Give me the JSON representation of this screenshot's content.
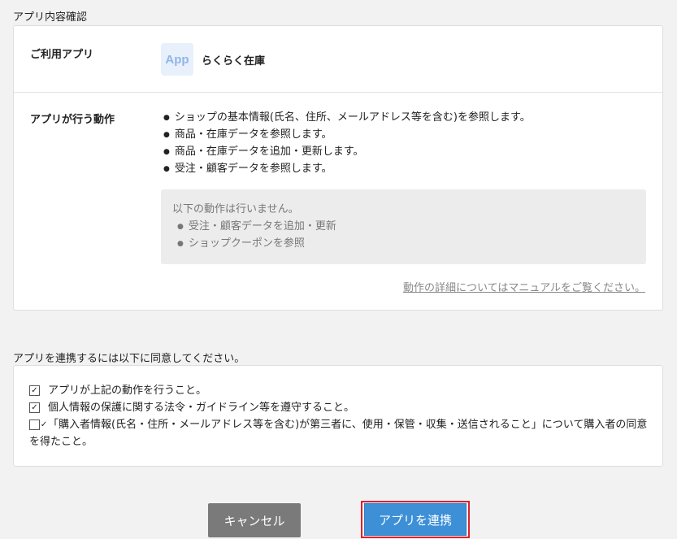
{
  "section_title": "アプリ内容確認",
  "app": {
    "label": "ご利用アプリ",
    "icon_text": "App",
    "name": "らくらく在庫"
  },
  "actions": {
    "label": "アプリが行う動作",
    "items": [
      "ショップの基本情報(氏名、住所、メールアドレス等を含む)を参照します。",
      "商品・在庫データを参照します。",
      "商品・在庫データを追加・更新します。",
      "受注・顧客データを参照します。"
    ],
    "not_performed": {
      "title": "以下の動作は行いません。",
      "items": [
        "受注・顧客データを追加・更新",
        "ショップクーポンを参照"
      ]
    },
    "manual_link": "動作の詳細についてはマニュアルをご覧ください。"
  },
  "agreement": {
    "title": "アプリを連携するには以下に同意してください。",
    "items": [
      {
        "text": "アプリが上記の動作を行うこと。",
        "checked": true
      },
      {
        "text": "個人情報の保護に関する法令・ガイドライン等を遵守すること。",
        "checked": true
      },
      {
        "text": "「購入者情報(氏名・住所・メールアドレス等を含む)が第三者に、使用・保管・収集・送信されること」について購入者の同意を得たこと。",
        "checked": true
      }
    ],
    "check_glyph": "✓"
  },
  "buttons": {
    "cancel": "キャンセル",
    "connect": "アプリを連携"
  },
  "colors": {
    "background": "#f2f2f2",
    "primary_button": "#3d8fd6",
    "cancel_button": "#7a7a7a",
    "highlight_border": "#e0202f",
    "app_icon_bg": "#e7f0fb"
  }
}
